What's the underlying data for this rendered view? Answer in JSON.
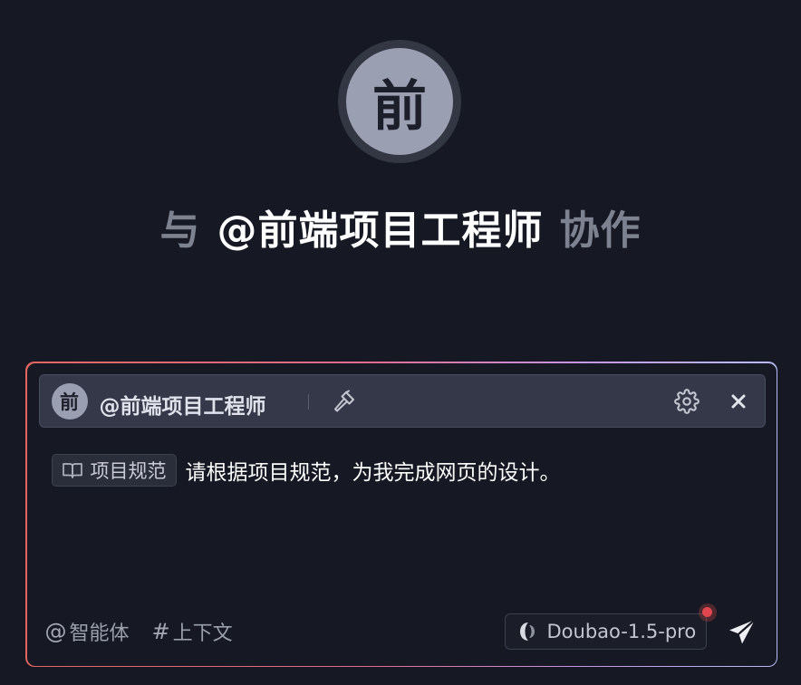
{
  "hero": {
    "avatar_char": "前",
    "title_prefix": "与",
    "title_agent": "@前端项目工程师",
    "title_suffix": "协作"
  },
  "composer": {
    "agent_bar": {
      "avatar_char": "前",
      "agent_name": "@前端项目工程师",
      "icons": [
        "hammer-icon",
        "gear-icon",
        "close-icon"
      ]
    },
    "message": {
      "chip_icon": "book-icon",
      "chip_label": "项目规范",
      "text": "请根据项目规范，为我完成网页的设计。"
    },
    "footer": {
      "agents_symbol": "@",
      "agents_label": "智能体",
      "context_symbol": "#",
      "context_label": "上下文",
      "model_label": "Doubao-1.5-pro",
      "model_icon": "doubao-logo-icon",
      "send_icon": "send-icon"
    }
  },
  "colors": {
    "background": "#161923",
    "bar_background": "#343848",
    "gradient_start": "#e2665e",
    "gradient_end": "#b6bdf3",
    "notify_dot": "#e2474f"
  }
}
